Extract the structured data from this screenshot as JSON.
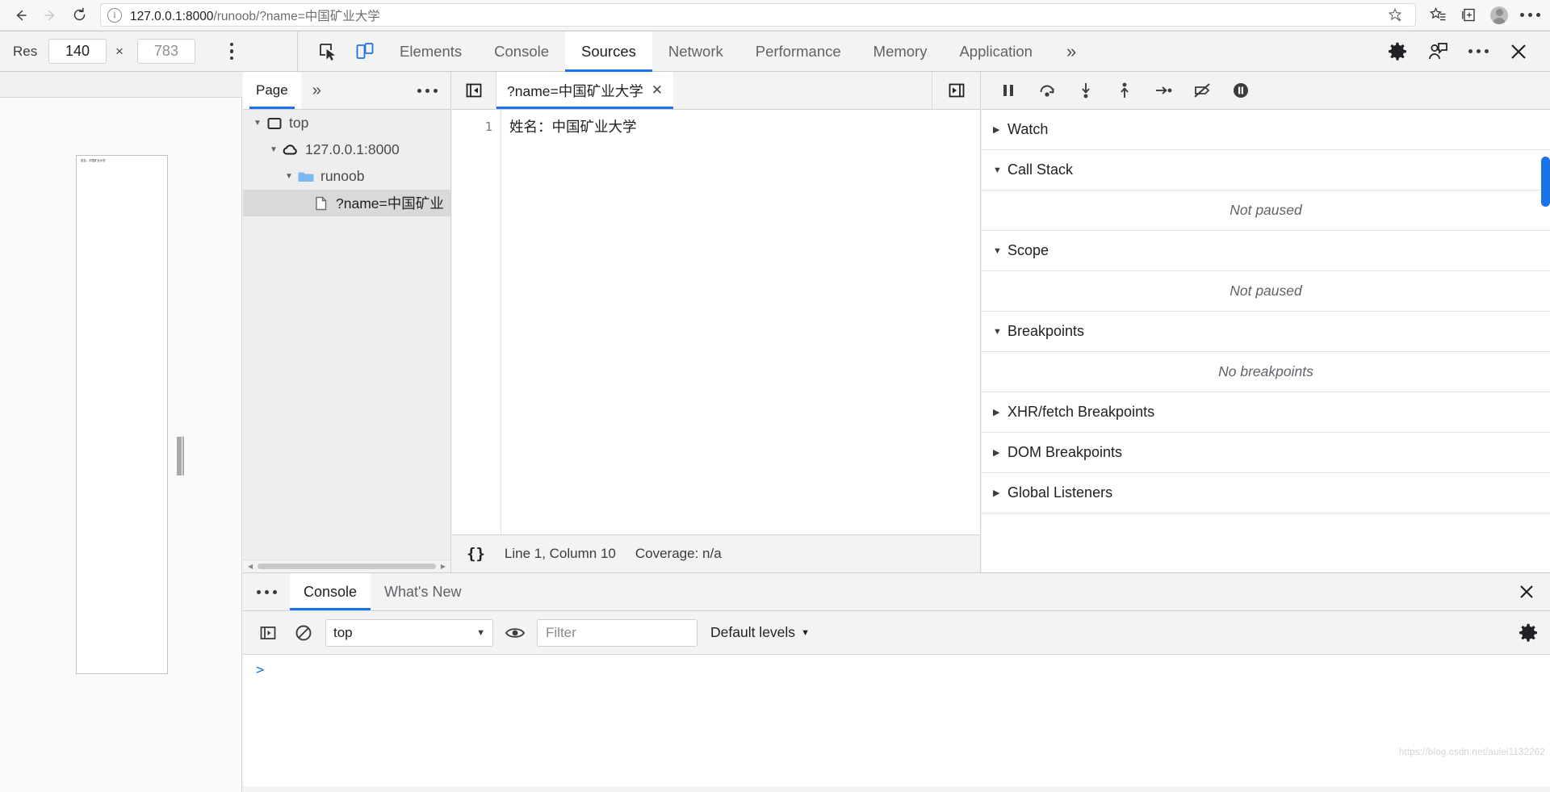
{
  "browser": {
    "back_label": "←",
    "forward_label": "→",
    "reload_label": "↻",
    "url_host": "127.0.0.1:8000",
    "url_path": "/runoob/?name=中国矿业大学",
    "url_full": "127.0.0.1:8000/runoob/?name=中国矿业大学",
    "icons": {
      "info": "i",
      "favorite_star": "favorite-star-icon",
      "favorites_list": "favorites-list-icon",
      "collections": "collections-icon",
      "profile": "profile-avatar-icon",
      "settings_more": "browser-more-icon"
    }
  },
  "devtools": {
    "device_toolbar": {
      "device_label": "Res",
      "width": "140",
      "height": "783",
      "separator": "×"
    },
    "tabs": [
      {
        "label": "Elements",
        "active": false
      },
      {
        "label": "Console",
        "active": false
      },
      {
        "label": "Sources",
        "active": true
      },
      {
        "label": "Network",
        "active": false
      },
      {
        "label": "Performance",
        "active": false
      },
      {
        "label": "Memory",
        "active": false
      },
      {
        "label": "Application",
        "active": false
      }
    ],
    "overflow_label": "»",
    "right_icons": {
      "settings": "gear-icon",
      "feedback": "feedback-icon",
      "more": "more-options-icon",
      "close": "close-devtools-icon"
    },
    "inspect_icon": "inspect-element-icon",
    "device_toggle_icon": "device-toolbar-icon"
  },
  "navigator": {
    "tab_label": "Page",
    "overflow_label": "»",
    "more_label": "more-options-icon",
    "tree": [
      {
        "label": "top",
        "icon": "frame-icon",
        "indent": 0,
        "selected": false,
        "expanded": true
      },
      {
        "label": "127.0.0.1:8000",
        "icon": "cloud-icon",
        "indent": 1,
        "selected": false,
        "expanded": true
      },
      {
        "label": "runoob",
        "icon": "folder-icon",
        "indent": 2,
        "selected": false,
        "expanded": true
      },
      {
        "label": "?name=中国矿业",
        "icon": "file-icon",
        "indent": 3,
        "selected": true,
        "expanded": false
      }
    ]
  },
  "editor": {
    "panel_toggle_icon": "show-navigator-icon",
    "right_toggle_icon": "show-debugger-icon",
    "file_tab": {
      "label": "?name=中国矿业大学",
      "close_label": "✕"
    },
    "lines": [
      {
        "number": "1",
        "text": "姓名：中国矿业大学"
      }
    ],
    "status": {
      "format_icon": "{}",
      "position": "Line 1, Column 10",
      "coverage": "Coverage: n/a"
    }
  },
  "debugger": {
    "toolbar_icons": [
      "pause-icon",
      "step-over-icon",
      "step-into-icon",
      "step-out-icon",
      "step-icon",
      "deactivate-breakpoints-icon",
      "pause-on-exceptions-icon"
    ],
    "sections": [
      {
        "label": "Watch",
        "expanded": false,
        "empty_text": ""
      },
      {
        "label": "Call Stack",
        "expanded": true,
        "empty_text": "Not paused"
      },
      {
        "label": "Scope",
        "expanded": true,
        "empty_text": "Not paused"
      },
      {
        "label": "Breakpoints",
        "expanded": true,
        "empty_text": "No breakpoints"
      },
      {
        "label": "XHR/fetch Breakpoints",
        "expanded": false,
        "empty_text": ""
      },
      {
        "label": "DOM Breakpoints",
        "expanded": false,
        "empty_text": ""
      },
      {
        "label": "Global Listeners",
        "expanded": false,
        "empty_text": ""
      }
    ]
  },
  "drawer": {
    "kebab_label": "more-tabs-icon",
    "tabs": [
      {
        "label": "Console",
        "active": true
      },
      {
        "label": "What's New",
        "active": false
      }
    ],
    "close_label": "✕",
    "console_toolbar": {
      "sidebar_icon": "console-sidebar-icon",
      "clear_icon": "clear-console-icon",
      "context_value": "top",
      "context_caret": "▼",
      "eye_icon": "live-expression-icon",
      "filter_placeholder": "Filter",
      "filter_value": "",
      "levels_label": "Default levels",
      "levels_caret": "▼",
      "settings_icon": "console-settings-icon"
    },
    "prompt_arrow": ">",
    "watermark": "https://blog.csdn.net/aulei1132262"
  },
  "preview": {
    "frame_text": "姓名：中国矿业大学"
  },
  "colors": {
    "accent": "#1a73e8",
    "toolbar_bg": "#f3f3f3",
    "panel_bg": "#ffffff",
    "tree_bg": "#eeeeee",
    "selected_row": "#d9d9d9",
    "folder_blue": "#7eb8f0",
    "text_primary": "#202124",
    "text_secondary": "#5f6368"
  }
}
